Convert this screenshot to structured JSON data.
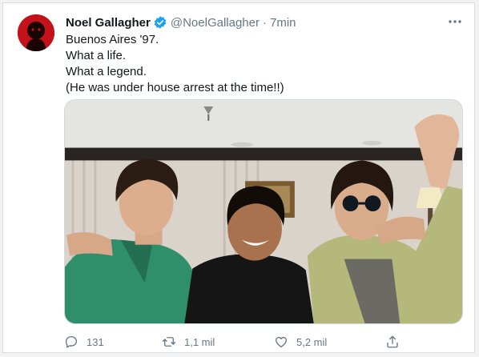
{
  "tweet": {
    "author_name": "Noel Gallagher",
    "handle": "@NoelGallagher",
    "separator": "·",
    "time": "7min",
    "verified": true,
    "lines": [
      "Buenos Aires '97.",
      "What a life.",
      "What a legend.",
      "(He was under house arrest at the time!!)"
    ]
  },
  "icons": {
    "avatar": "avatar-image",
    "verified": "verified-badge-icon",
    "more": "more-options-icon",
    "reply": "reply-icon",
    "retweet": "retweet-icon",
    "like": "heart-icon",
    "share": "share-icon"
  },
  "actions": {
    "replies": "131",
    "retweets": "1,1 mil",
    "likes": "5,2 mil"
  },
  "colors": {
    "name": "#14171a",
    "secondary": "#657786",
    "verified": "#1da1f2",
    "avatar_bg": "#c4121a"
  }
}
